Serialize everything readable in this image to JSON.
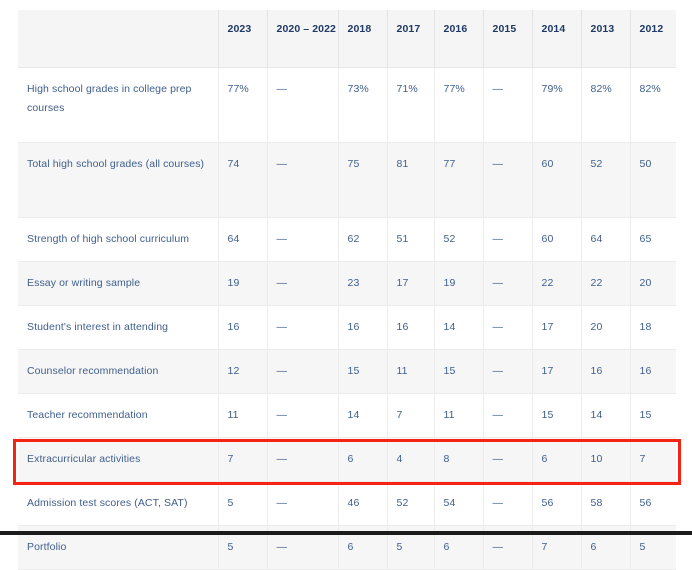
{
  "table": {
    "name": "factors-in-admission-decisions",
    "first_column_header": "",
    "column_headers": [
      "2023",
      "2020 – 2022",
      "2018",
      "2017",
      "2016",
      "2015",
      "2014",
      "2013",
      "2012"
    ],
    "rows": [
      {
        "label": "High school grades in college prep courses",
        "values": [
          "77%",
          "—",
          "73%",
          "71%",
          "77%",
          "—",
          "79%",
          "82%",
          "82%"
        ],
        "highlighted": false
      },
      {
        "label": "Total high school grades (all courses)",
        "values": [
          "74",
          "—",
          "75",
          "81",
          "77",
          "—",
          "60",
          "52",
          "50"
        ],
        "highlighted": false
      },
      {
        "label": "Strength of high school curriculum",
        "values": [
          "64",
          "—",
          "62",
          "51",
          "52",
          "—",
          "60",
          "64",
          "65"
        ],
        "highlighted": false
      },
      {
        "label": "Essay or writing sample",
        "values": [
          "19",
          "—",
          "23",
          "17",
          "19",
          "—",
          "22",
          "22",
          "20"
        ],
        "highlighted": false
      },
      {
        "label": "Student's interest in attending",
        "values": [
          "16",
          "—",
          "16",
          "16",
          "14",
          "—",
          "17",
          "20",
          "18"
        ],
        "highlighted": false
      },
      {
        "label": "Counselor recommendation",
        "values": [
          "12",
          "—",
          "15",
          "11",
          "15",
          "—",
          "17",
          "16",
          "16"
        ],
        "highlighted": false
      },
      {
        "label": "Teacher recommendation",
        "values": [
          "11",
          "—",
          "14",
          "7",
          "11",
          "—",
          "15",
          "14",
          "15"
        ],
        "highlighted": false
      },
      {
        "label": "Extracurricular activities",
        "values": [
          "7",
          "—",
          "6",
          "4",
          "8",
          "—",
          "6",
          "10",
          "7"
        ],
        "highlighted": false
      },
      {
        "label": "Admission test scores (ACT, SAT)",
        "values": [
          "5",
          "—",
          "46",
          "52",
          "54",
          "—",
          "56",
          "58",
          "56"
        ],
        "highlighted": true
      },
      {
        "label": "Portfolio",
        "values": [
          "5",
          "—",
          "6",
          "5",
          "6",
          "—",
          "7",
          "6",
          "5"
        ],
        "highlighted": false
      }
    ]
  },
  "annotation": {
    "type": "rectangle-outline",
    "color": "#f52314",
    "target_row_label": "Admission test scores (ACT, SAT)"
  },
  "colors": {
    "header_text": "#1f3a66",
    "body_text": "#3f5f8c",
    "header_background": "#f5f5f5",
    "row_background_odd": "#ffffff",
    "row_background_even": "#f6f6f6",
    "grid_line": "#ececec",
    "annotation_red": "#f52314",
    "page_edge": "#1c1c1c"
  }
}
